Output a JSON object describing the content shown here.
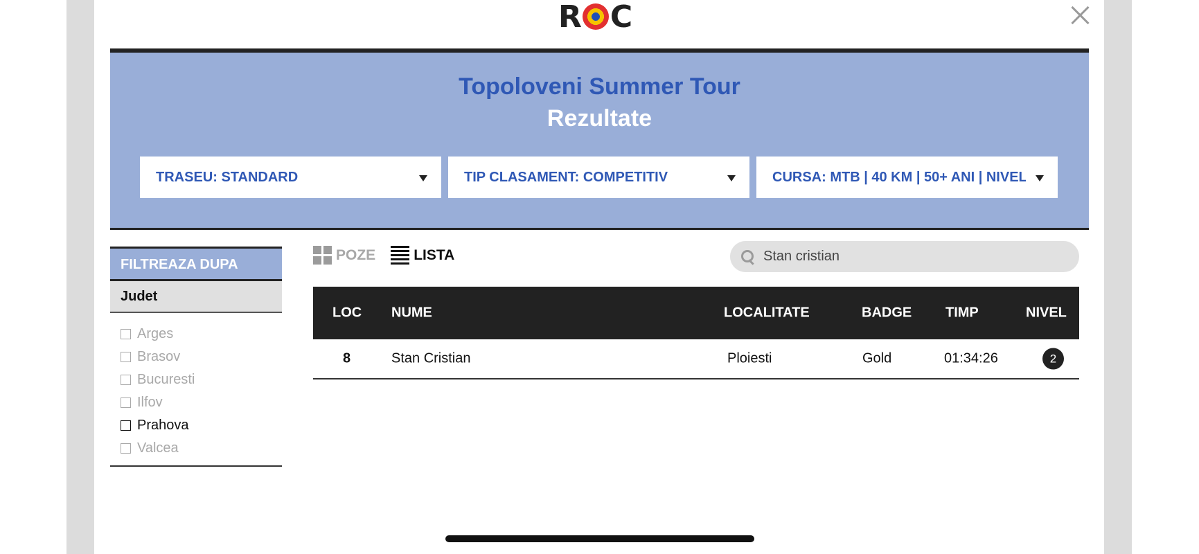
{
  "header": {
    "logo_text_left": "R",
    "logo_text_right": "C"
  },
  "hero": {
    "title": "Topoloveni Summer Tour",
    "subtitle": "Rezultate",
    "dropdowns": [
      {
        "label": "TRASEU: STANDARD"
      },
      {
        "label": "TIP CLASAMENT: COMPETITIV"
      },
      {
        "label": "CURSA: MTB | 40 KM | 50+ ANI | NIVEL"
      }
    ]
  },
  "filter": {
    "heading": "FILTREAZA DUPA",
    "group": "Judet",
    "options": [
      "Arges",
      "Brasov",
      "Bucuresti",
      "Ilfov",
      "Prahova",
      "Valcea"
    ]
  },
  "view": {
    "poze": "POZE",
    "lista": "LISTA"
  },
  "search": {
    "value": "Stan cristian"
  },
  "table": {
    "columns": [
      "LOC",
      "NUME",
      "LOCALITATE",
      "BADGE",
      "TIMP",
      "NIVEL"
    ],
    "rows": [
      {
        "loc": "8",
        "nume": "Stan Cristian",
        "localitate": "Ploiesti",
        "badge": "Gold",
        "timp": "01:34:26",
        "nivel": "2"
      }
    ]
  },
  "colors": {
    "accent": "#2f58b5",
    "hero_bg": "#99aed8",
    "dark": "#222222"
  }
}
